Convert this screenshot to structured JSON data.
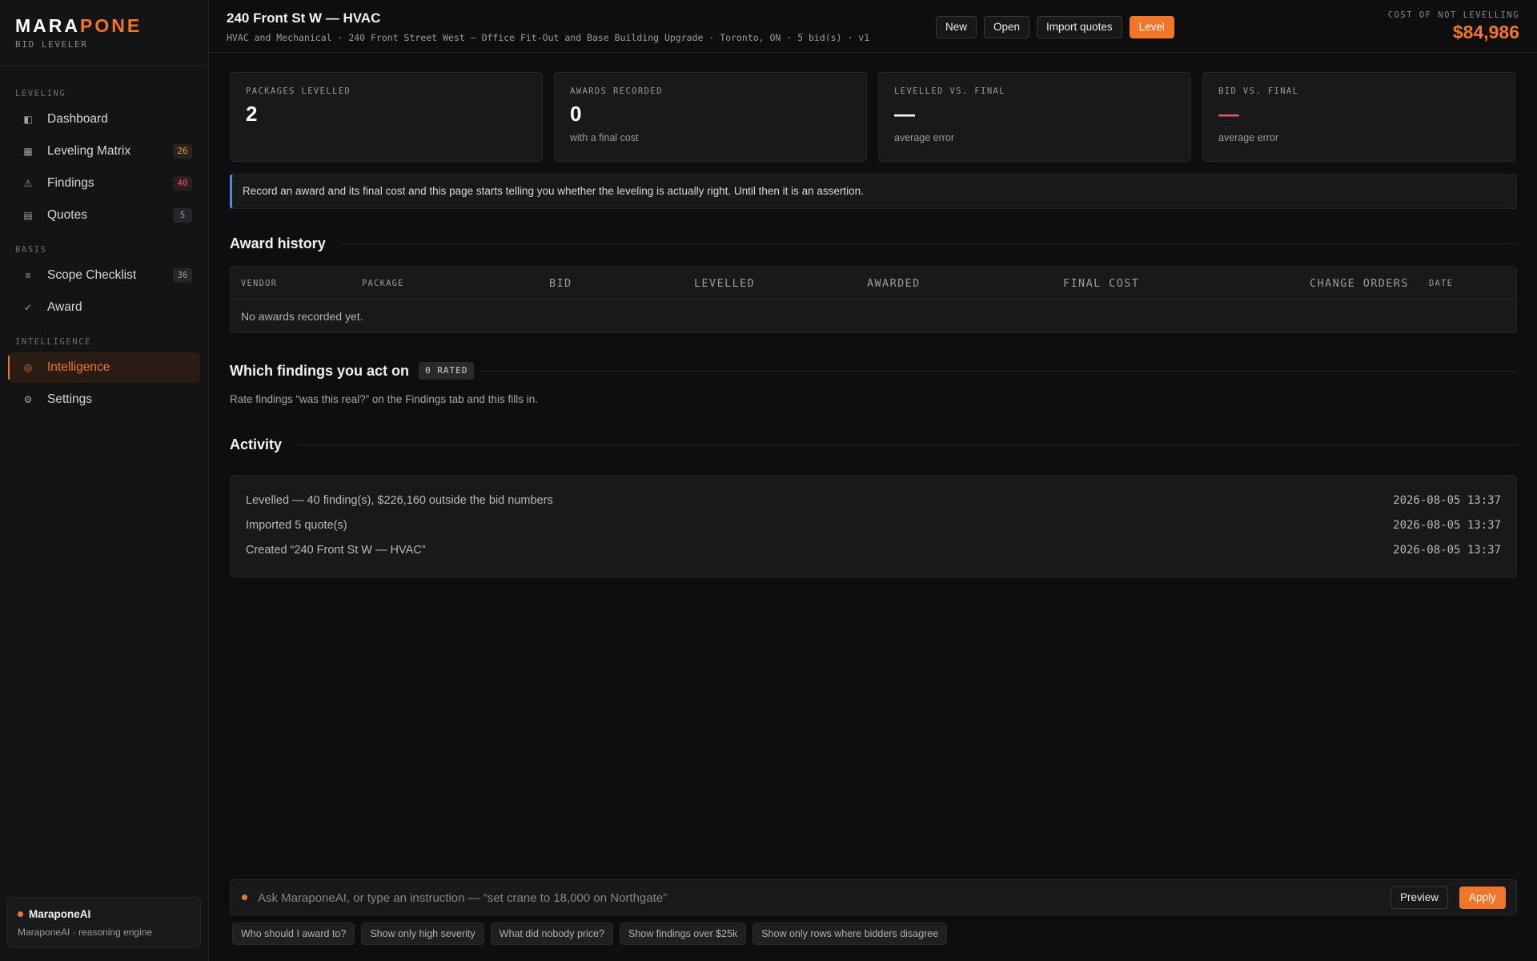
{
  "brand": {
    "name_main": "MARA",
    "name_accent": "PONE",
    "subtitle": "BID LEVELER"
  },
  "sidebar": {
    "sections": [
      {
        "title": "LEVELING",
        "items": [
          {
            "label": "Dashboard",
            "icon": "dashboard-icon",
            "badge": ""
          },
          {
            "label": "Leveling Matrix",
            "icon": "grid-icon",
            "badge": "26"
          },
          {
            "label": "Findings",
            "icon": "warning-icon",
            "badge": "40"
          },
          {
            "label": "Quotes",
            "icon": "document-icon",
            "badge": "5"
          }
        ]
      },
      {
        "title": "BASIS",
        "items": [
          {
            "label": "Scope Checklist",
            "icon": "list-icon",
            "badge": "36"
          },
          {
            "label": "Award",
            "icon": "check-icon",
            "badge": ""
          }
        ]
      },
      {
        "title": "INTELLIGENCE",
        "items": [
          {
            "label": "Intelligence",
            "icon": "target-icon",
            "badge": "",
            "active": true
          },
          {
            "label": "Settings",
            "icon": "gear-icon",
            "badge": ""
          }
        ]
      }
    ],
    "ai_card": {
      "title": "MaraponeAI",
      "subtitle": "MaraponeAI · reasoning engine"
    }
  },
  "header": {
    "title": "240 Front St W — HVAC",
    "subtitle": "HVAC and Mechanical · 240 Front Street West — Office Fit-Out and Base Building Upgrade · Toronto, ON · 5 bid(s) · v1",
    "actions": {
      "new": "New",
      "open": "Open",
      "import": "Import quotes",
      "level": "Level"
    },
    "cost_label": "COST OF NOT LEVELLING",
    "cost_value": "$84,986"
  },
  "stats": [
    {
      "label": "PACKAGES LEVELLED",
      "value": "2",
      "note": ""
    },
    {
      "label": "AWARDS RECORDED",
      "value": "0",
      "note": "with a final cost"
    },
    {
      "label": "LEVELLED VS. FINAL",
      "value": "—",
      "note": "average error"
    },
    {
      "label": "BID VS. FINAL",
      "value": "—",
      "note": "average error"
    }
  ],
  "notice": "Record an award and its final cost and this page starts telling you whether the leveling is actually right. Until then it is an assertion.",
  "award_history": {
    "title": "Award history",
    "columns": {
      "vendor": "VENDOR",
      "package": "PACKAGE",
      "bid": "BID",
      "levelled": "LEVELLED",
      "awarded": "AWARDED",
      "final_cost": "FINAL COST",
      "change_orders": "CHANGE ORDERS",
      "date": "DATE"
    },
    "empty": "No awards recorded yet."
  },
  "findings_section": {
    "title": "Which findings you act on",
    "badge": "0 RATED",
    "text": "Rate findings “was this real?” on the Findings tab and this fills in."
  },
  "activity": {
    "title": "Activity",
    "rows": [
      {
        "text": "Levelled — 40 finding(s), $226,160 outside the bid numbers",
        "time": "2026-08-05 13:37"
      },
      {
        "text": "Imported 5 quote(s)",
        "time": "2026-08-05 13:37"
      },
      {
        "text": "Created “240 Front St W — HVAC”",
        "time": "2026-08-05 13:37"
      }
    ]
  },
  "command": {
    "placeholder": "Ask MaraponeAI, or type an instruction — “set crane to 18,000 on Northgate”",
    "preview": "Preview",
    "apply": "Apply",
    "suggestions": [
      "Who should I award to?",
      "Show only high severity",
      "What did nobody price?",
      "Show findings over $25k",
      "Show only rows where bidders disagree"
    ]
  },
  "colors": {
    "accent": "#f0762a",
    "danger": "#e05a5a",
    "info": "#4a8fd8",
    "background": "#0e0e10"
  }
}
